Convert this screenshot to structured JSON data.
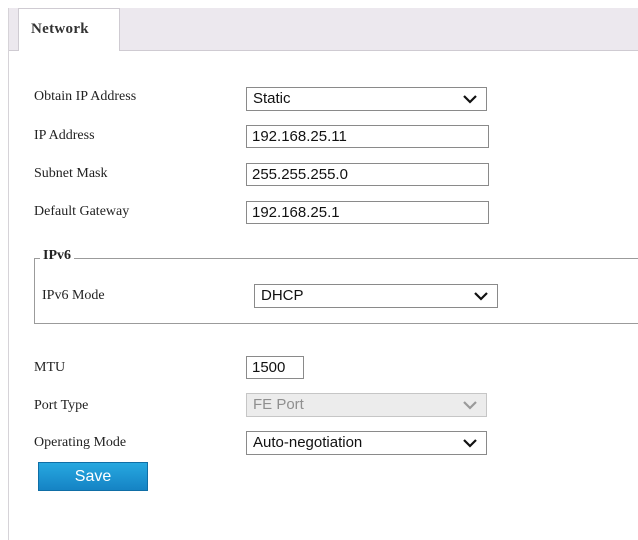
{
  "tab": {
    "label": "Network"
  },
  "form": {
    "obtain_ip": {
      "label": "Obtain IP Address",
      "value": "Static"
    },
    "ip_address": {
      "label": "IP Address",
      "value": "192.168.25.11"
    },
    "subnet_mask": {
      "label": "Subnet Mask",
      "value": "255.255.255.0"
    },
    "default_gateway": {
      "label": "Default Gateway",
      "value": "192.168.25.1"
    },
    "ipv6": {
      "legend": "IPv6",
      "mode": {
        "label": "IPv6 Mode",
        "value": "DHCP"
      }
    },
    "mtu": {
      "label": "MTU",
      "value": "1500"
    },
    "port_type": {
      "label": "Port Type",
      "value": "FE Port",
      "disabled": true
    },
    "operating_mode": {
      "label": "Operating Mode",
      "value": "Auto-negotiation"
    }
  },
  "save_button": {
    "label": "Save"
  },
  "colors": {
    "accent": "#1b95d4",
    "tab_strip": "#ece8ee"
  },
  "icons": {
    "dropdown": "chevron-down-icon"
  }
}
